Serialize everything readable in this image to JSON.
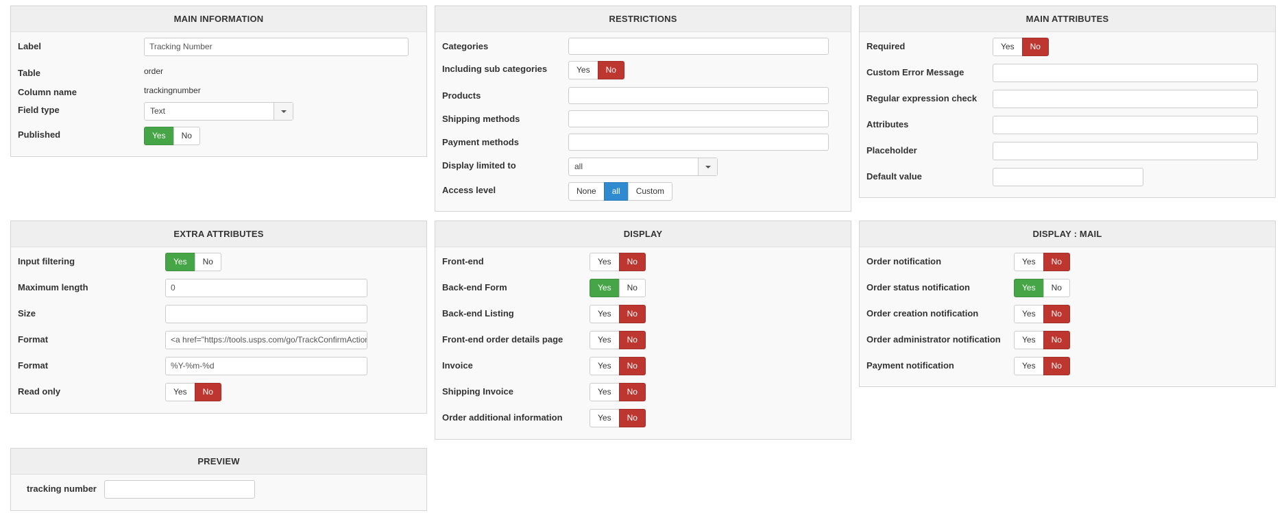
{
  "main_info": {
    "title": "MAIN INFORMATION",
    "label_lbl": "Label",
    "label_value": "Tracking Number",
    "table_lbl": "Table",
    "table_value": "order",
    "column_lbl": "Column name",
    "column_value": "trackingnumber",
    "fieldtype_lbl": "Field type",
    "fieldtype_value": "Text",
    "published_lbl": "Published"
  },
  "restrictions": {
    "title": "RESTRICTIONS",
    "categories_lbl": "Categories",
    "subcats_lbl": "Including sub categories",
    "products_lbl": "Products",
    "shipping_lbl": "Shipping methods",
    "payment_lbl": "Payment methods",
    "display_limited_lbl": "Display limited to",
    "display_limited_value": "all",
    "access_lbl": "Access level",
    "access_none": "None",
    "access_all": "all",
    "access_custom": "Custom"
  },
  "main_attributes": {
    "title": "MAIN ATTRIBUTES",
    "required_lbl": "Required",
    "custom_error_lbl": "Custom Error Message",
    "regex_lbl": "Regular expression check",
    "attributes_lbl": "Attributes",
    "placeholder_lbl": "Placeholder",
    "default_lbl": "Default value"
  },
  "extra_attributes": {
    "title": "EXTRA ATTRIBUTES",
    "input_filter_lbl": "Input filtering",
    "max_length_lbl": "Maximum length",
    "max_length_value": "0",
    "size_lbl": "Size",
    "format1_lbl": "Format",
    "format1_value": "<a href=\"https://tools.usps.com/go/TrackConfirmAction?",
    "format2_lbl": "Format",
    "format2_value": "%Y-%m-%d",
    "readonly_lbl": "Read only"
  },
  "display": {
    "title": "DISPLAY",
    "frontend_lbl": "Front-end",
    "backend_form_lbl": "Back-end Form",
    "backend_listing_lbl": "Back-end Listing",
    "frontend_order_lbl": "Front-end order details page",
    "invoice_lbl": "Invoice",
    "shipping_invoice_lbl": "Shipping Invoice",
    "order_additional_lbl": "Order additional information"
  },
  "display_mail": {
    "title": "DISPLAY : MAIL",
    "order_notif_lbl": "Order notification",
    "order_status_lbl": "Order status notification",
    "order_creation_lbl": "Order creation notification",
    "order_admin_lbl": "Order administrator notification",
    "payment_notif_lbl": "Payment notification"
  },
  "preview": {
    "title": "PREVIEW",
    "tracking_lbl": "tracking number"
  },
  "toggle": {
    "yes": "Yes",
    "no": "No"
  },
  "colors": {
    "yes_active": "#46a546",
    "no_active": "#bd362f",
    "blue_active": "#2f8ad0"
  }
}
